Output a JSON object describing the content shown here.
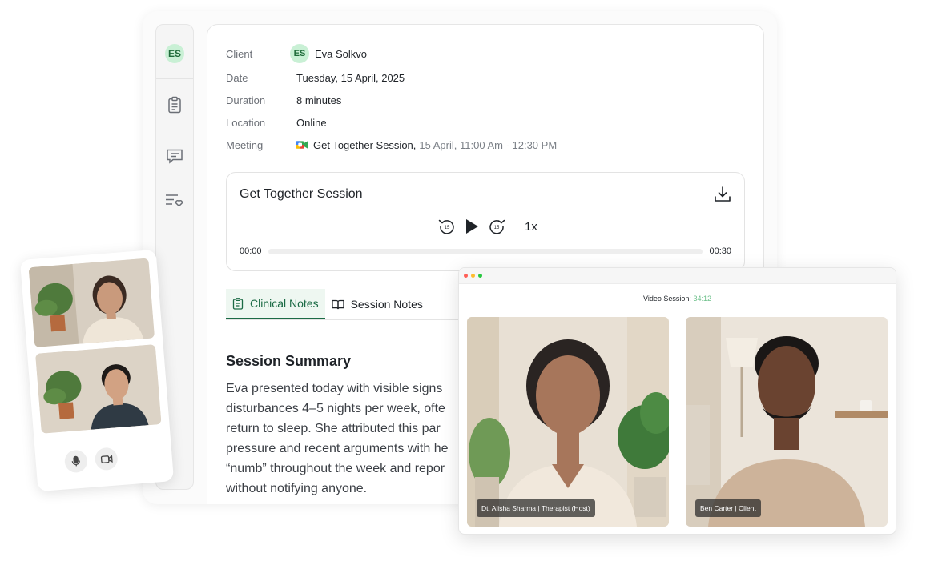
{
  "sidebar": {
    "avatar_initials": "ES",
    "items": [
      {
        "icon": "clipboard-icon"
      },
      {
        "icon": "message-icon"
      },
      {
        "icon": "list-heart-icon"
      }
    ]
  },
  "client_info": {
    "client_label": "Client",
    "client_initials": "ES",
    "client_name": "Eva Solkvo",
    "date_label": "Date",
    "date_value": "Tuesday, 15 April, 2025",
    "duration_label": "Duration",
    "duration_value": "8 minutes",
    "location_label": "Location",
    "location_value": "Online",
    "meeting_label": "Meeting",
    "meeting_name": "Get Together Session,",
    "meeting_time": "15 April, 11:00 Am - 12:30 PM"
  },
  "player": {
    "title": "Get Together Session",
    "rewind_seconds": "15",
    "forward_seconds": "15",
    "speed": "1x",
    "current_time": "00:00",
    "total_time": "00:30",
    "progress": 0
  },
  "tabs": [
    {
      "label": "Clinical Notes",
      "active": true
    },
    {
      "label": "Session Notes",
      "active": false
    }
  ],
  "summary": {
    "title": "Session Summary",
    "lines": [
      "Eva presented today with visible signs",
      "disturbances 4–5 nights per week, ofte",
      "return to sleep. She attributed this par",
      "pressure and recent arguments with he",
      "“numb” throughout the week and repor",
      "without notifying anyone."
    ]
  },
  "video_session": {
    "label": "Video Session:",
    "timer": "34:12",
    "participants": [
      {
        "name": "Dt. Alisha Sharma | Therapist (Host)"
      },
      {
        "name": "Ben Carter | Client"
      }
    ]
  },
  "colors": {
    "accent": "#1b6b45",
    "badge_bg": "#c9f0d5",
    "timer": "#6cc08a"
  }
}
